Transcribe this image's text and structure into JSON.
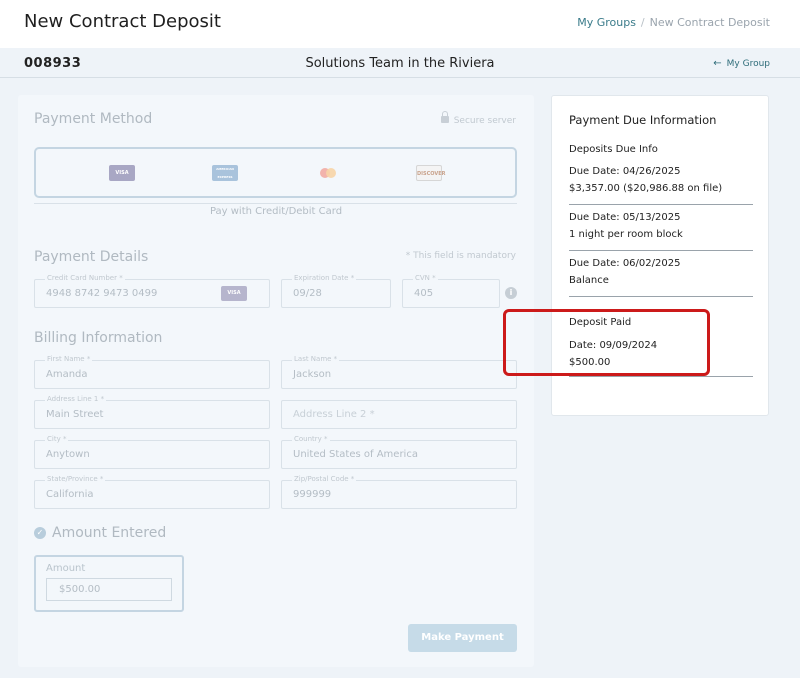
{
  "header": {
    "title": "New Contract Deposit",
    "breadcrumb": {
      "link": "My Groups",
      "separator": "/",
      "current": "New Contract Deposit"
    }
  },
  "subheader": {
    "contract_id": "008933",
    "group_name": "Solutions Team in the Riviera",
    "back_arrow": "←",
    "back_label": "My Group"
  },
  "payment_method": {
    "title": "Payment Method",
    "secure_label": "Secure server",
    "cards": [
      {
        "name": "visa",
        "text": "VISA"
      },
      {
        "name": "amex",
        "text": "AMERICAN EXPRESS"
      },
      {
        "name": "mastercard",
        "text": ""
      },
      {
        "name": "discover",
        "text": "DISCOVER"
      }
    ],
    "pay_with": "Pay with Credit/Debit Card"
  },
  "payment_details": {
    "title": "Payment Details",
    "mandatory_note": "* This field is mandatory",
    "card_number": {
      "label": "Credit Card Number  *",
      "value": "4948 8742 9473 0499",
      "card_logo": "VISA"
    },
    "expiration": {
      "label": "Expiration Date  *",
      "value": "09/28"
    },
    "cvn": {
      "label": "CVN  *",
      "value": "405"
    },
    "info_icon": "i"
  },
  "billing": {
    "title": "Billing Information",
    "first_name": {
      "label": "First Name *",
      "value": "Amanda"
    },
    "last_name": {
      "label": "Last Name *",
      "value": "Jackson"
    },
    "address1": {
      "label": "Address Line 1 *",
      "value": "Main Street"
    },
    "address2": {
      "placeholder": "Address Line 2 *"
    },
    "city": {
      "label": "City *",
      "value": "Anytown"
    },
    "country": {
      "label": "Country *",
      "value": "United States of America"
    },
    "state": {
      "label": "State/Province *",
      "value": "California"
    },
    "zip": {
      "label": "Zip/Postal Code *",
      "value": "999999"
    }
  },
  "amount": {
    "title": "Amount Entered",
    "check": "✓",
    "label": "Amount",
    "value": "$500.00"
  },
  "make_payment_label": "Make Payment",
  "due_info": {
    "title": "Payment Due Information",
    "subtitle": "Deposits Due Info",
    "items": [
      {
        "date": "Due Date: 04/26/2025",
        "detail": "$3,357.00 ($20,986.88 on file)"
      },
      {
        "date": "Due Date: 05/13/2025",
        "detail": "1 night per room block"
      },
      {
        "date": "Due Date: 06/02/2025",
        "detail": "Balance"
      }
    ],
    "paid": {
      "title": "Deposit Paid",
      "date": "Date: 09/09/2024",
      "amount": "$500.00"
    }
  },
  "colors": {
    "highlight": "#cc1a1a",
    "accent": "#3a7b8a"
  }
}
